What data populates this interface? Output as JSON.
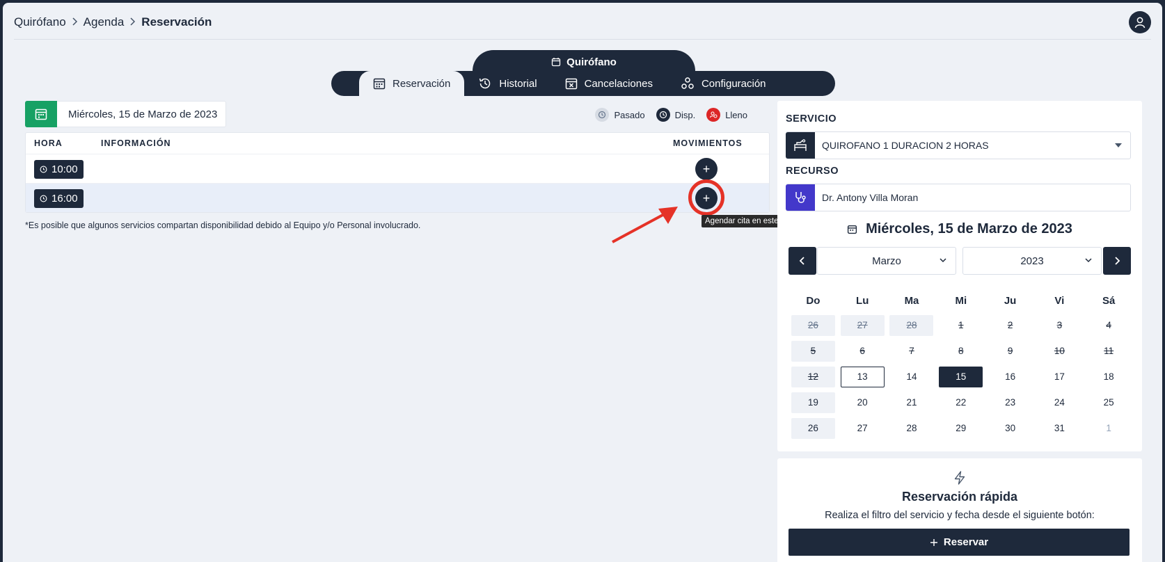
{
  "breadcrumb": {
    "item1": "Quirófano",
    "item2": "Agenda",
    "current": "Reservación"
  },
  "nav": {
    "top_label": "Quirófano",
    "tabs": [
      {
        "label": "Reservación",
        "icon": "calendar-grid-icon",
        "active": true
      },
      {
        "label": "Historial",
        "icon": "history-icon",
        "active": false
      },
      {
        "label": "Cancelaciones",
        "icon": "calendar-x-icon",
        "active": false
      },
      {
        "label": "Configuración",
        "icon": "cogs-icon",
        "active": false
      }
    ]
  },
  "date_selector": {
    "value": "Miércoles, 15 de Marzo de 2023"
  },
  "legend": {
    "past": {
      "label": "Pasado",
      "color": "#cbd5e1"
    },
    "available": {
      "label": "Disp.",
      "color": "#1e293b"
    },
    "full": {
      "label": "Lleno",
      "color": "#dc2626"
    }
  },
  "table": {
    "headers": {
      "hora": "HORA",
      "info": "INFORMACIÓN",
      "movimientos": "MOVIMIENTOS"
    },
    "rows": [
      {
        "time": "10:00",
        "info": ""
      },
      {
        "time": "16:00",
        "info": ""
      }
    ],
    "add_label": "+"
  },
  "tooltip": "Agendar cita en este horario",
  "note": "*Es posible que algunos servicios compartan disponibilidad debido al Equipo y/o Personal involucrado.",
  "service": {
    "label": "SERVICIO",
    "value": "QUIROFANO 1 DURACION 2 HORAS"
  },
  "resource": {
    "label": "RECURSO",
    "value": "Dr. Antony Villa Moran"
  },
  "calendar": {
    "title": "Miércoles, 15 de Marzo de 2023",
    "month": "Marzo",
    "year": "2023",
    "weekdays": [
      "Do",
      "Lu",
      "Ma",
      "Mi",
      "Ju",
      "Vi",
      "Sá"
    ],
    "weeks": [
      [
        "26",
        "27",
        "28",
        "1",
        "2",
        "3",
        "4"
      ],
      [
        "5",
        "6",
        "7",
        "8",
        "9",
        "10",
        "11"
      ],
      [
        "12",
        "13",
        "14",
        "15",
        "16",
        "17",
        "18"
      ],
      [
        "19",
        "20",
        "21",
        "22",
        "23",
        "24",
        "25"
      ],
      [
        "26",
        "27",
        "28",
        "29",
        "30",
        "31",
        "1"
      ]
    ]
  },
  "quick": {
    "title": "Reservación rápida",
    "subtitle": "Realiza el filtro del servicio y fecha desde el siguiente botón:",
    "button": "Reservar"
  },
  "colors": {
    "primary": "#1e293b",
    "green": "#17a164",
    "purple": "#4338ca",
    "annotation_red": "#e53227"
  }
}
